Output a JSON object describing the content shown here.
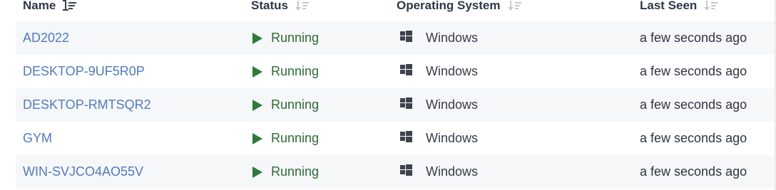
{
  "columns": {
    "name": "Name",
    "status": "Status",
    "os": "Operating System",
    "last_seen": "Last Seen"
  },
  "rows": [
    {
      "name": "AD2022",
      "status": "Running",
      "os": "Windows",
      "last_seen": "a few seconds ago"
    },
    {
      "name": "DESKTOP-9UF5R0P",
      "status": "Running",
      "os": "Windows",
      "last_seen": "a few seconds ago"
    },
    {
      "name": "DESKTOP-RMTSQR2",
      "status": "Running",
      "os": "Windows",
      "last_seen": "a few seconds ago"
    },
    {
      "name": "GYM",
      "status": "Running",
      "os": "Windows",
      "last_seen": "a few seconds ago"
    },
    {
      "name": "WIN-SVJCO4AO55V",
      "status": "Running",
      "os": "Windows",
      "last_seen": "a few seconds ago"
    }
  ],
  "colors": {
    "link": "#4f7bbd",
    "running": "#2e6b35",
    "row_stripe": "#f6f7f9"
  },
  "icons": {
    "name_sort": "sort-ascending-icon",
    "other_sort": "sort-inactive-icon",
    "status": "play-icon",
    "os": "windows-icon"
  }
}
